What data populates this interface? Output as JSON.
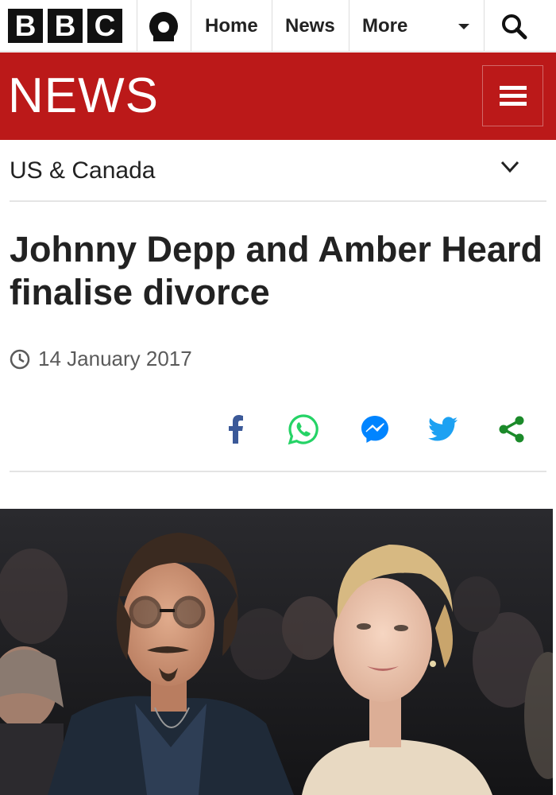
{
  "header": {
    "logo_letters": [
      "B",
      "B",
      "C"
    ],
    "nav": [
      {
        "label": "Home"
      },
      {
        "label": "News"
      },
      {
        "label": "More"
      }
    ],
    "icons": {
      "account": "account-icon",
      "search": "search-icon",
      "more_caret": "caret-down-icon"
    }
  },
  "news_band": {
    "title": "NEWS",
    "color": "#bb1919",
    "menu_icon": "hamburger-menu-icon"
  },
  "section": {
    "label": "US & Canada",
    "icon": "chevron-down-icon"
  },
  "article": {
    "headline": "Johnny Depp and Amber Heard finalise divorce",
    "date": "14 January 2017",
    "date_icon": "clock-icon"
  },
  "share": {
    "icons": [
      "facebook-icon",
      "whatsapp-icon",
      "messenger-icon",
      "twitter-icon",
      "share-icon"
    ],
    "colors": {
      "facebook": "#3b5998",
      "whatsapp": "#25d366",
      "messenger": "#0084ff",
      "twitter": "#1da1f2",
      "share": "#1b8a2a"
    }
  },
  "photo": {
    "subject": "Johnny Depp and Amber Heard at a red-carpet event"
  }
}
